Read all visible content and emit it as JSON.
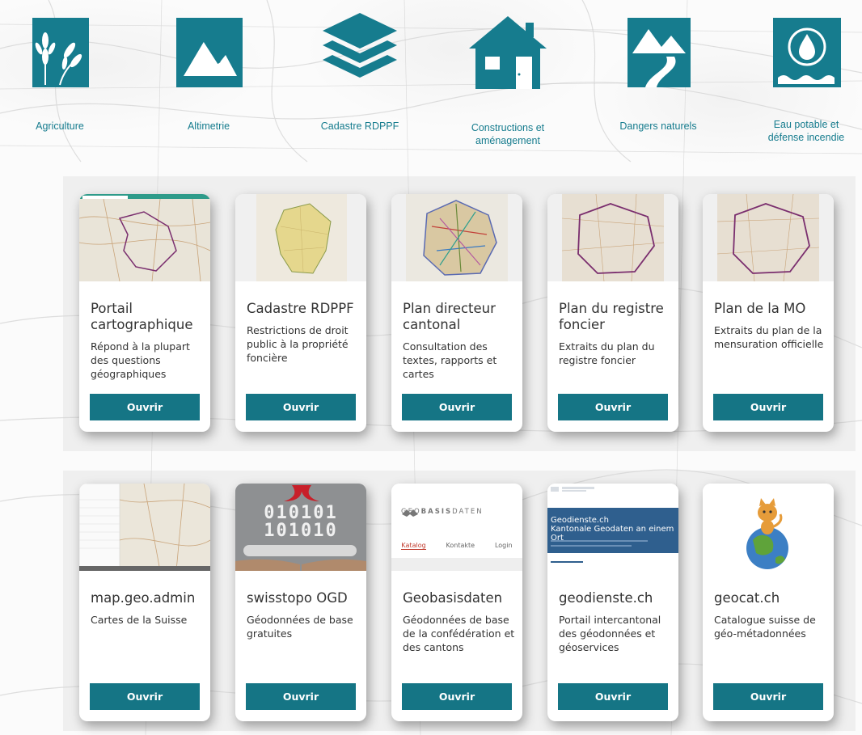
{
  "categories": [
    {
      "label": "Agriculture",
      "icon": "wheat-icon"
    },
    {
      "label": "Altimetrie",
      "icon": "mountain-icon"
    },
    {
      "label": "Cadastre RDPPF",
      "icon": "layers-icon"
    },
    {
      "label": "Constructions et aménagement",
      "icon": "house-icon"
    },
    {
      "label": "Dangers naturels",
      "icon": "mountain-road-icon"
    },
    {
      "label": "Eau potable et défense incendie",
      "icon": "water-drop-icon"
    }
  ],
  "cards_row1": [
    {
      "title": "Portail cartographique",
      "desc": "Répond à la plupart des questions géographiques",
      "button": "Ouvrir"
    },
    {
      "title": "Cadastre RDPPF",
      "desc": "Restrictions de droit public à la propriété foncière",
      "button": "Ouvrir"
    },
    {
      "title": "Plan directeur cantonal",
      "desc": "Consultation des textes, rapports et cartes",
      "button": "Ouvrir"
    },
    {
      "title": "Plan du registre foncier",
      "desc": "Extraits du plan du registre foncier",
      "button": "Ouvrir"
    },
    {
      "title": "Plan de la MO",
      "desc": "Extraits du plan de la mensuration officielle",
      "button": "Ouvrir"
    }
  ],
  "cards_row2": [
    {
      "title": "map.geo.admin",
      "desc": "Cartes de la Suisse",
      "button": "Ouvrir"
    },
    {
      "title": "swisstopo OGD",
      "desc": "Géodonnées de base gratuites",
      "button": "Ouvrir",
      "thumb_text": [
        "010101",
        "101010"
      ]
    },
    {
      "title": "Geobasisdaten",
      "desc": "Géodonnées de base de la confédération et des cantons",
      "button": "Ouvrir",
      "thumb_brand_a": "GEO",
      "thumb_brand_b": "BASIS",
      "thumb_brand_c": "DATEN",
      "thumb_tabs": [
        "Katalog",
        "Kontakte",
        "Login"
      ]
    },
    {
      "title": "geodienste.ch",
      "desc": "Portail intercantonal des géodonnées et géoservices",
      "button": "Ouvrir",
      "thumb_heading": "Geodienste.ch",
      "thumb_sub": "Kantonale Geodaten an einem Ort"
    },
    {
      "title": "geocat.ch",
      "desc": "Catalogue suisse de géo-métadonnées",
      "button": "Ouvrir"
    }
  ],
  "colors": {
    "accent": "#157585",
    "icon_teal": "#167c8e",
    "label": "#167c8e",
    "text": "#333333"
  }
}
